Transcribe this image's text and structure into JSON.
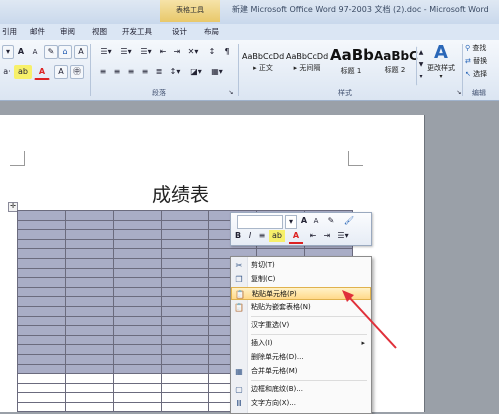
{
  "titlebar": {
    "context_tab_group": "表格工具",
    "document_title": "新建 Microsoft Office Word 97-2003 文档 (2).doc - Microsoft Word"
  },
  "tabs": [
    "引用",
    "邮件",
    "审阅",
    "视图",
    "开发工具",
    "设计",
    "布局"
  ],
  "ribbon": {
    "font_group": {
      "grow_font": "A",
      "shrink_font": "A",
      "clear_format": "A"
    },
    "paragraph_group_label": "段落",
    "styles_group_label": "样式",
    "editing_group_label": "编辑",
    "styles": [
      {
        "sample": "AaBbCcDd",
        "name": "▸ 正文"
      },
      {
        "sample": "AaBbCcDd",
        "name": "▸ 无间隔"
      },
      {
        "sample": "AaBb",
        "name": "标题 1"
      },
      {
        "sample": "AaBbC",
        "name": "标题 2"
      }
    ],
    "change_styles": "更改样式",
    "find": "查找",
    "replace": "替换",
    "select": "选择"
  },
  "document": {
    "heading": "成绩表"
  },
  "mini_toolbar": {
    "bold": "B",
    "italic": "I",
    "align": "≡",
    "font_color": "A"
  },
  "context_menu": {
    "items": [
      {
        "label": "剪切(T)",
        "icon": "scissors-icon"
      },
      {
        "label": "复制(C)",
        "icon": "copy-icon"
      },
      {
        "label": "粘贴单元格(P)",
        "icon": "paste-icon",
        "highlighted": true
      },
      {
        "label": "粘贴为嵌套表格(N)",
        "icon": "paste-nested-icon"
      },
      {
        "label": "汉字重选(V)",
        "icon": ""
      },
      {
        "label": "插入(I)",
        "icon": "",
        "submenu": true
      },
      {
        "label": "删除单元格(D)...",
        "icon": ""
      },
      {
        "label": "合并单元格(M)",
        "icon": "merge-icon"
      },
      {
        "label": "边框和底纹(B)...",
        "icon": "border-icon"
      },
      {
        "label": "文字方向(X)...",
        "icon": "text-direction-icon"
      }
    ]
  },
  "colors": {
    "selection": "#a9adc6",
    "arrow": "#e0303a",
    "menu_highlight": "#ffd98a"
  }
}
